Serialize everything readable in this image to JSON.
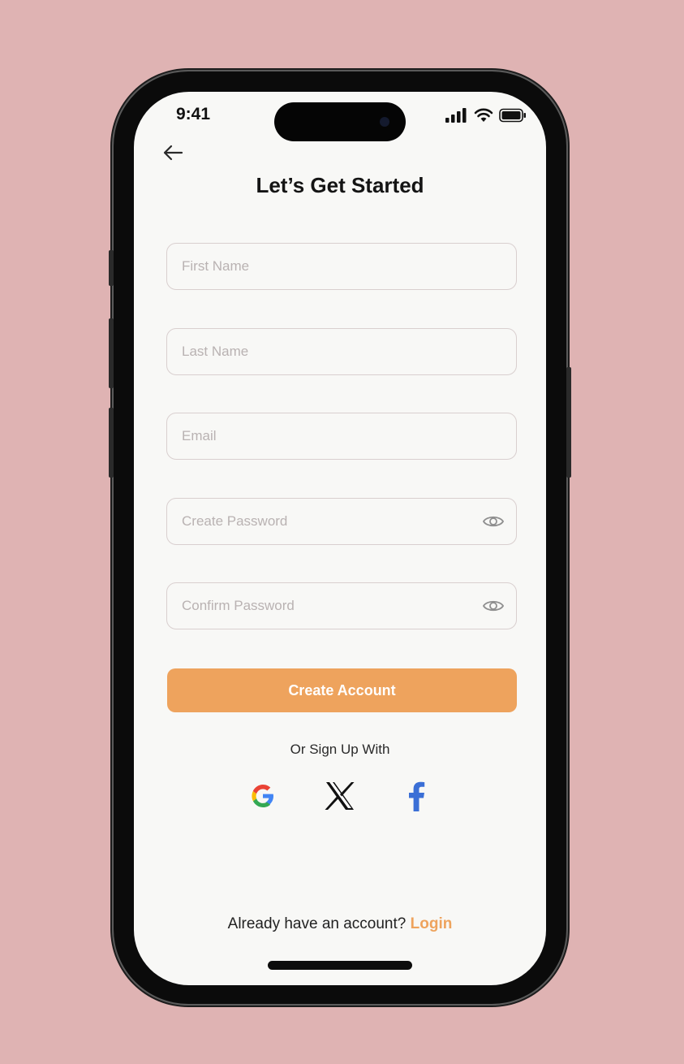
{
  "status_bar": {
    "time": "9:41"
  },
  "header": {
    "title": "Let’s Get Started"
  },
  "form": {
    "first_name": {
      "placeholder": "First Name",
      "value": ""
    },
    "last_name": {
      "placeholder": "Last Name",
      "value": ""
    },
    "email": {
      "placeholder": "Email",
      "value": ""
    },
    "create_password": {
      "placeholder": "Create Password",
      "value": ""
    },
    "confirm_password": {
      "placeholder": "Confirm Password",
      "value": ""
    }
  },
  "actions": {
    "create_account_label": "Create Account"
  },
  "social": {
    "label": "Or Sign Up With",
    "providers": [
      {
        "name": "google",
        "icon": "google-icon"
      },
      {
        "name": "x",
        "icon": "x-icon"
      },
      {
        "name": "facebook",
        "icon": "facebook-icon"
      }
    ]
  },
  "footer": {
    "prompt": "Already have an account? ",
    "login_label": "Login"
  },
  "colors": {
    "background": "#dfb3b3",
    "screen": "#f8f8f6",
    "accent": "#eea35d",
    "field_border": "#d9cfcf",
    "placeholder": "#b9b2b2"
  }
}
